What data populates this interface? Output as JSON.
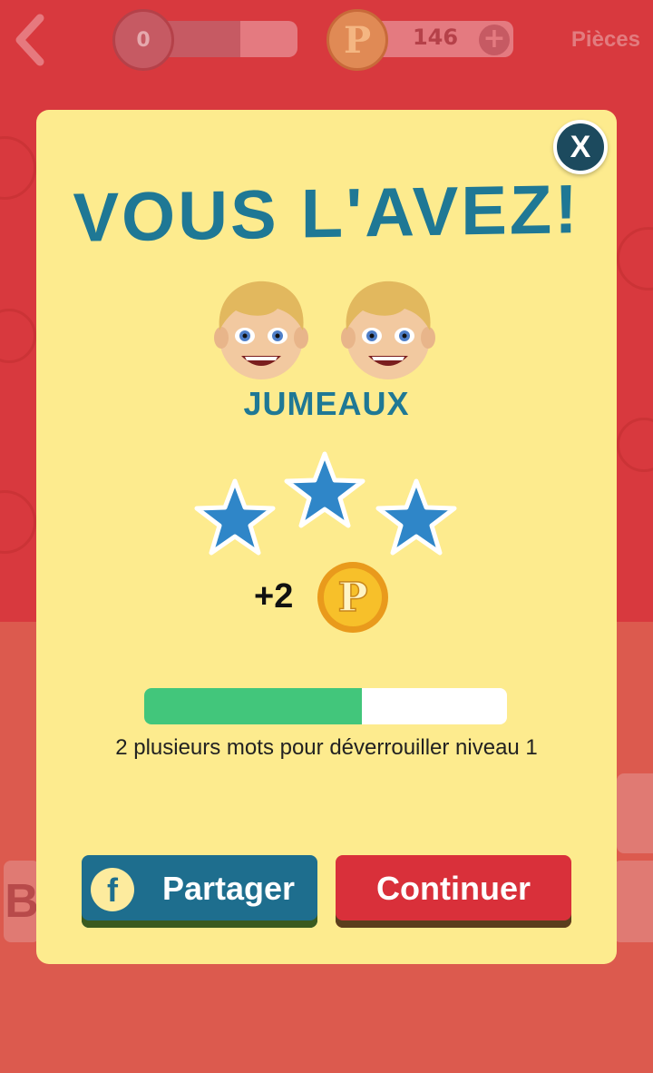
{
  "header": {
    "xp_level": "0",
    "xp_progress": 0.6,
    "coins_count": "146",
    "coins_plus": "+",
    "coins_label": "Pièces",
    "coin_letter": "P"
  },
  "background": {
    "tile_letter_left": "B"
  },
  "modal": {
    "close_label": "X",
    "title": "VOUS L'AVEZ!",
    "answer": "JUMEAUX",
    "stars_earned": 3,
    "stars_total": 3,
    "reward_text": "+2",
    "reward_coin_letter": "P",
    "progress_fraction": 0.6,
    "progress_text": "2 plusieurs mots pour déverrouiller niveau 1",
    "share_icon": "f",
    "share_label": "Partager",
    "continue_label": "Continuer"
  },
  "colors": {
    "accent": "#1f7895",
    "modal_bg": "#fdeb8e",
    "progress_fill": "#42c67b",
    "star": "#2f86c8",
    "continue_btn": "#d9303a",
    "share_btn": "#1e6e8e"
  },
  "icons": [
    "back-arrow-icon",
    "coin-icon",
    "plus-icon",
    "close-icon",
    "boy-emoji-icon",
    "star-icon",
    "facebook-icon"
  ]
}
